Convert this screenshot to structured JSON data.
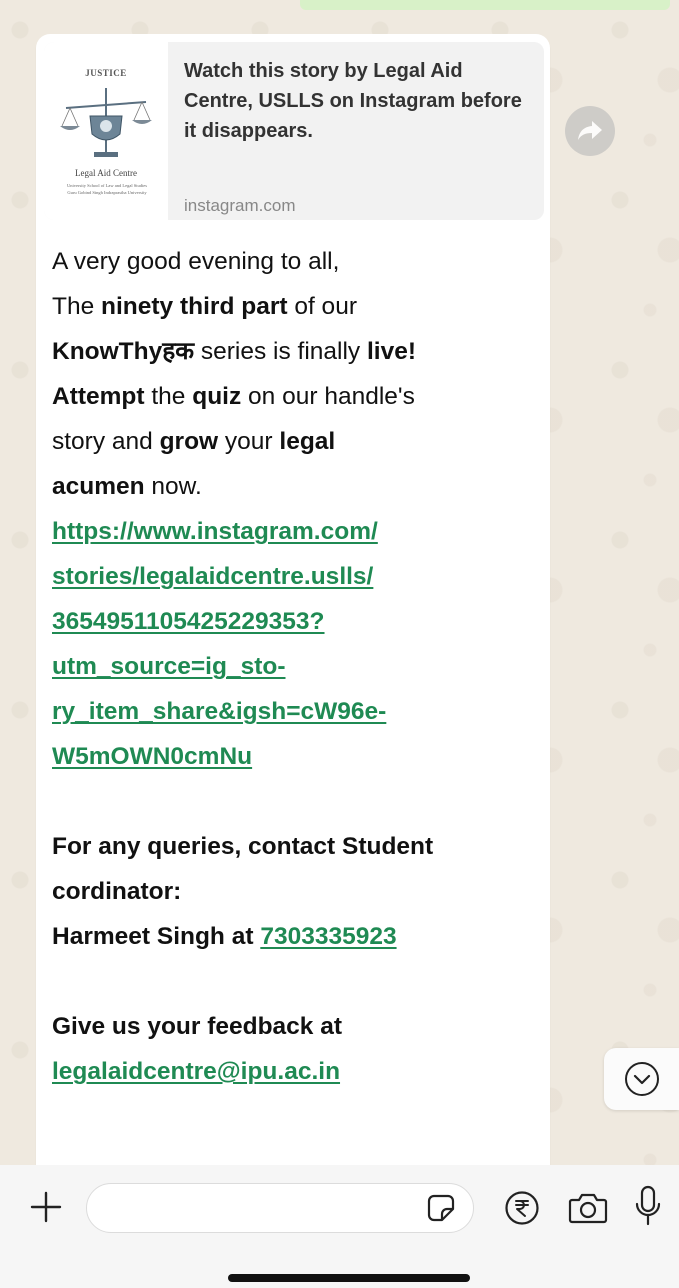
{
  "link_preview": {
    "thumbnail_top_text": "JUSTICE",
    "thumbnail_title": "Legal Aid Centre",
    "thumbnail_subtitle_1": "University School of Law and Legal Studies",
    "thumbnail_subtitle_2": "Guru Gobind Singh Indraprastha University",
    "title": "Watch this story by Legal Aid Centre, USLLS on Instagram before it disappears.",
    "domain": "instagram.com"
  },
  "message": {
    "greeting": "A very good evening to all,",
    "p1_pre": "The ",
    "p1_bold": "ninety third part",
    "p1_post": " of our",
    "p2_bold1": "KnowThyहक",
    "p2_mid": " series is finally ",
    "p2_bold2": "live!",
    "p3_bold1": "Attempt",
    "p3_mid": " the ",
    "p3_bold2": "quiz",
    "p3_post": " on our handle's",
    "p4_pre": "story and ",
    "p4_bold1": "grow",
    "p4_mid": " your ",
    "p4_bold2": "legal",
    "p5_bold": "acumen",
    "p5_post": " now.",
    "link_lines": [
      "https://www.instagram.com/",
      "stories/legalaidcentre.uslls/",
      "3654951105425229353?",
      "utm_source=ig_sto-",
      "ry_item_share&igsh=cW96e-",
      "W5mOWN0cmNu"
    ],
    "contact_line1": "For any queries, contact Student",
    "contact_line2": "cordinator:",
    "contact_name": "Harmeet Singh at ",
    "contact_phone": "7303335923",
    "feedback_label": "Give us your feedback at",
    "feedback_email": "legalaidcentre@ipu.ac.in"
  },
  "composer": {
    "input_value": ""
  },
  "icons": {
    "forward": "forward-icon",
    "scroll_down": "chevron-down-circle-icon",
    "plus": "plus-icon",
    "sticker": "sticker-icon",
    "payment": "rupee-icon",
    "camera": "camera-icon",
    "mic": "microphone-icon"
  },
  "colors": {
    "link": "#1f8a53",
    "bubble": "#ffffff",
    "wallpaper": "#efe9df"
  }
}
